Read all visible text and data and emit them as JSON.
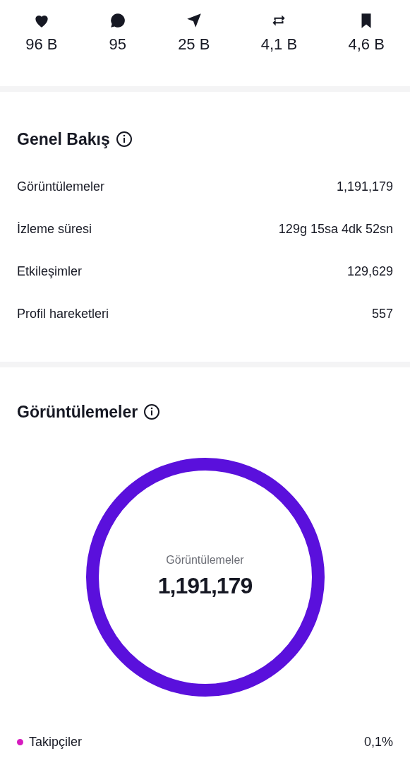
{
  "stats": [
    {
      "kind": "heart",
      "value": "96 B"
    },
    {
      "kind": "comment",
      "value": "95"
    },
    {
      "kind": "send",
      "value": "25 B"
    },
    {
      "kind": "repost",
      "value": "4,1 B"
    },
    {
      "kind": "bookmark",
      "value": "4,6 B"
    }
  ],
  "overview": {
    "title": "Genel Bakış",
    "rows": [
      {
        "label": "Görüntülemeler",
        "value": "1,191,179"
      },
      {
        "label": "İzleme süresi",
        "value": "129g 15sa 4dk 52sn"
      },
      {
        "label": "Etkileşimler",
        "value": "129,629"
      },
      {
        "label": "Profil hareketleri",
        "value": "557"
      }
    ]
  },
  "views": {
    "title": "Görüntülemeler",
    "center_label": "Görüntülemeler",
    "center_value": "1,191,179",
    "legend": [
      {
        "label": "Takipçiler",
        "value": "0,1%",
        "color": "#d61bbf"
      }
    ]
  }
}
